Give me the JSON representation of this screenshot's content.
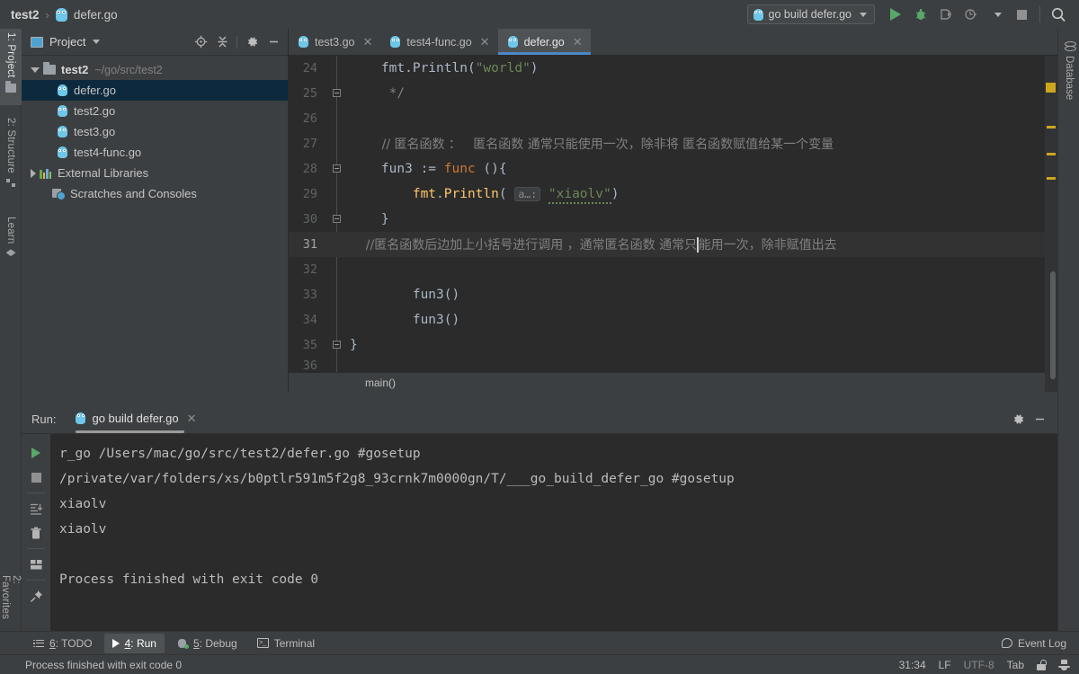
{
  "window": {
    "breadcrumb": {
      "project": "test2",
      "separator": "›",
      "file": "defer.go"
    }
  },
  "toolbar": {
    "run_config": "go build defer.go",
    "icons": [
      "run-icon",
      "debug-icon",
      "run-with-coverage-icon",
      "profiler-icon",
      "stop-icon",
      "search-everywhere-icon"
    ]
  },
  "left_tool_strip": {
    "tabs": [
      {
        "label": "1: Project",
        "icon": "project-folder-icon",
        "active": true
      },
      {
        "label": "2: Structure",
        "icon": "structure-icon",
        "active": false
      },
      {
        "label": "Learn",
        "icon": "learn-icon",
        "active": false
      }
    ],
    "bottom_tabs": [
      {
        "label": "2: Favorites",
        "icon": "star-icon"
      },
      {
        "label": "",
        "icon": "window-icon"
      }
    ]
  },
  "right_tool_strip": {
    "tabs": [
      {
        "label": "Database",
        "icon": "database-icon"
      }
    ]
  },
  "project_panel": {
    "title": "Project",
    "tools": [
      "locate-icon",
      "collapse-all-icon",
      "settings-gear-icon",
      "hide-icon"
    ],
    "tree": [
      {
        "label": "test2",
        "path": "~/go/src/test2",
        "type": "folder",
        "expanded": true,
        "selected": false,
        "indent": 0
      },
      {
        "label": "defer.go",
        "type": "go-file",
        "selected": true,
        "indent": 1
      },
      {
        "label": "test2.go",
        "type": "go-file",
        "selected": false,
        "indent": 1
      },
      {
        "label": "test3.go",
        "type": "go-file",
        "selected": false,
        "indent": 1
      },
      {
        "label": "test4-func.go",
        "type": "go-file",
        "selected": false,
        "indent": 1
      },
      {
        "label": "External Libraries",
        "type": "libraries",
        "expanded": false,
        "selected": false,
        "indent": 0
      },
      {
        "label": "Scratches and Consoles",
        "type": "scratches",
        "selected": false,
        "indent": 0
      }
    ]
  },
  "editor": {
    "tabs": [
      {
        "label": "test3.go",
        "active": false
      },
      {
        "label": "test4-func.go",
        "active": false
      },
      {
        "label": "defer.go",
        "active": true
      }
    ],
    "breadcrumb": "main()",
    "lines": [
      {
        "num": "24",
        "text": "        fmt.Println(\"world\")"
      },
      {
        "num": "25",
        "text": "         */"
      },
      {
        "num": "26",
        "text": ""
      },
      {
        "num": "27",
        "text": "        // 匿名函数 ：   匿名函数 通常只能使用一次，除非将 匿名函数赋值给某一个变量"
      },
      {
        "num": "28",
        "text": "        fun3 := func (){"
      },
      {
        "num": "29",
        "text": "            fmt.Println( a…: \"xiaolv\")"
      },
      {
        "num": "30",
        "text": "        }"
      },
      {
        "num": "31",
        "text": "        //匿名函数后边加上小括号进行调用 ，通常匿名函数 通常只能用一次，除非赋值出去"
      },
      {
        "num": "32",
        "text": ""
      },
      {
        "num": "33",
        "text": "        fun3()"
      },
      {
        "num": "34",
        "text": "        fun3()"
      },
      {
        "num": "35",
        "text": "    }"
      },
      {
        "num": "36",
        "text": ""
      }
    ],
    "line29_hint": "a…:",
    "line29_string": "\"xiaolv\"",
    "active_line": "31"
  },
  "run_panel": {
    "label": "Run:",
    "tab": "go build defer.go",
    "tools": [
      "settings-gear-icon",
      "hide-icon"
    ],
    "console_toolbar": [
      "rerun-icon",
      "stop-icon",
      "scroll-to-end-icon",
      "trash-icon",
      "soft-wrap-icon",
      "pin-icon"
    ],
    "console_lines": [
      "r_go /Users/mac/go/src/test2/defer.go #gosetup",
      "/private/var/folders/xs/b0ptlr591m5f2g8_93crnk7m0000gn/T/___go_build_defer_go #gosetup",
      "xiaolv",
      "xiaolv",
      "",
      "Process finished with exit code 0"
    ]
  },
  "bottom_bar": {
    "tabs": [
      {
        "label_num": "6",
        "label_text": ": TODO",
        "icon": "todo-list-icon",
        "active": false
      },
      {
        "label_num": "4",
        "label_text": ": Run",
        "icon": "run-icon",
        "active": true
      },
      {
        "label_num": "5",
        "label_text": ": Debug",
        "icon": "debug-bug-icon",
        "active": false
      },
      {
        "label_num": "",
        "label_text": "Terminal",
        "icon": "terminal-icon",
        "active": false
      }
    ],
    "event_log": "Event Log"
  },
  "status_bar": {
    "message": "Process finished with exit code 0",
    "caret_position": "31:34",
    "line_separator": "LF",
    "encoding": "UTF-8",
    "indent": "Tab",
    "icons": [
      "unlocked-padlock-icon",
      "detective-hat-icon"
    ]
  },
  "colors": {
    "panel_bg": "#3c3f41",
    "editor_bg": "#2b2b2b",
    "accent_blue": "#4a88c7",
    "selection_blue": "#0d293e",
    "green_run": "#59a869",
    "keyword_orange": "#cc7832",
    "string_green": "#6a8759",
    "function_yellow": "#ffc66d",
    "comment_gray": "#808080",
    "marker_yellow": "#cda51f"
  }
}
